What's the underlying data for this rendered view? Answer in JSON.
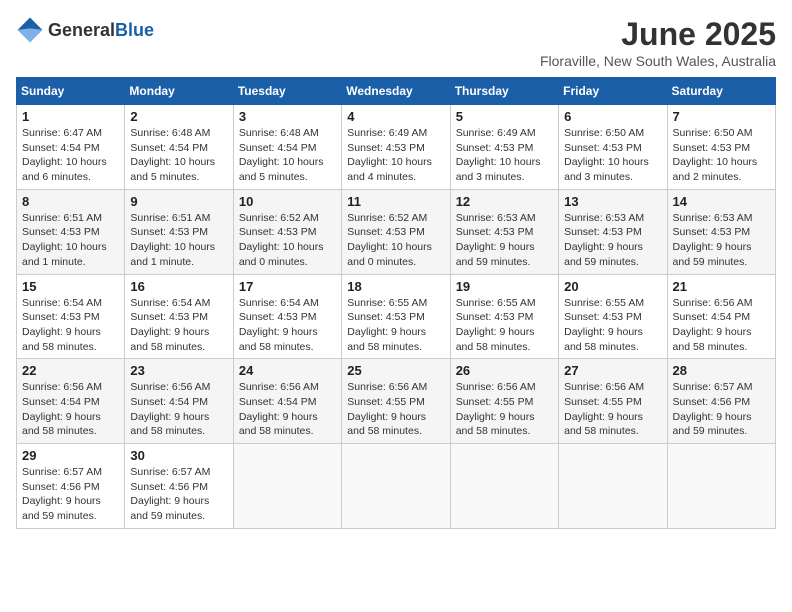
{
  "header": {
    "logo_general": "General",
    "logo_blue": "Blue",
    "month_title": "June 2025",
    "location": "Floraville, New South Wales, Australia"
  },
  "weekdays": [
    "Sunday",
    "Monday",
    "Tuesday",
    "Wednesday",
    "Thursday",
    "Friday",
    "Saturday"
  ],
  "weeks": [
    [
      {
        "day": "1",
        "info": "Sunrise: 6:47 AM\nSunset: 4:54 PM\nDaylight: 10 hours\nand 6 minutes."
      },
      {
        "day": "2",
        "info": "Sunrise: 6:48 AM\nSunset: 4:54 PM\nDaylight: 10 hours\nand 5 minutes."
      },
      {
        "day": "3",
        "info": "Sunrise: 6:48 AM\nSunset: 4:54 PM\nDaylight: 10 hours\nand 5 minutes."
      },
      {
        "day": "4",
        "info": "Sunrise: 6:49 AM\nSunset: 4:53 PM\nDaylight: 10 hours\nand 4 minutes."
      },
      {
        "day": "5",
        "info": "Sunrise: 6:49 AM\nSunset: 4:53 PM\nDaylight: 10 hours\nand 3 minutes."
      },
      {
        "day": "6",
        "info": "Sunrise: 6:50 AM\nSunset: 4:53 PM\nDaylight: 10 hours\nand 3 minutes."
      },
      {
        "day": "7",
        "info": "Sunrise: 6:50 AM\nSunset: 4:53 PM\nDaylight: 10 hours\nand 2 minutes."
      }
    ],
    [
      {
        "day": "8",
        "info": "Sunrise: 6:51 AM\nSunset: 4:53 PM\nDaylight: 10 hours\nand 1 minute."
      },
      {
        "day": "9",
        "info": "Sunrise: 6:51 AM\nSunset: 4:53 PM\nDaylight: 10 hours\nand 1 minute."
      },
      {
        "day": "10",
        "info": "Sunrise: 6:52 AM\nSunset: 4:53 PM\nDaylight: 10 hours\nand 0 minutes."
      },
      {
        "day": "11",
        "info": "Sunrise: 6:52 AM\nSunset: 4:53 PM\nDaylight: 10 hours\nand 0 minutes."
      },
      {
        "day": "12",
        "info": "Sunrise: 6:53 AM\nSunset: 4:53 PM\nDaylight: 9 hours\nand 59 minutes."
      },
      {
        "day": "13",
        "info": "Sunrise: 6:53 AM\nSunset: 4:53 PM\nDaylight: 9 hours\nand 59 minutes."
      },
      {
        "day": "14",
        "info": "Sunrise: 6:53 AM\nSunset: 4:53 PM\nDaylight: 9 hours\nand 59 minutes."
      }
    ],
    [
      {
        "day": "15",
        "info": "Sunrise: 6:54 AM\nSunset: 4:53 PM\nDaylight: 9 hours\nand 58 minutes."
      },
      {
        "day": "16",
        "info": "Sunrise: 6:54 AM\nSunset: 4:53 PM\nDaylight: 9 hours\nand 58 minutes."
      },
      {
        "day": "17",
        "info": "Sunrise: 6:54 AM\nSunset: 4:53 PM\nDaylight: 9 hours\nand 58 minutes."
      },
      {
        "day": "18",
        "info": "Sunrise: 6:55 AM\nSunset: 4:53 PM\nDaylight: 9 hours\nand 58 minutes."
      },
      {
        "day": "19",
        "info": "Sunrise: 6:55 AM\nSunset: 4:53 PM\nDaylight: 9 hours\nand 58 minutes."
      },
      {
        "day": "20",
        "info": "Sunrise: 6:55 AM\nSunset: 4:53 PM\nDaylight: 9 hours\nand 58 minutes."
      },
      {
        "day": "21",
        "info": "Sunrise: 6:56 AM\nSunset: 4:54 PM\nDaylight: 9 hours\nand 58 minutes."
      }
    ],
    [
      {
        "day": "22",
        "info": "Sunrise: 6:56 AM\nSunset: 4:54 PM\nDaylight: 9 hours\nand 58 minutes."
      },
      {
        "day": "23",
        "info": "Sunrise: 6:56 AM\nSunset: 4:54 PM\nDaylight: 9 hours\nand 58 minutes."
      },
      {
        "day": "24",
        "info": "Sunrise: 6:56 AM\nSunset: 4:54 PM\nDaylight: 9 hours\nand 58 minutes."
      },
      {
        "day": "25",
        "info": "Sunrise: 6:56 AM\nSunset: 4:55 PM\nDaylight: 9 hours\nand 58 minutes."
      },
      {
        "day": "26",
        "info": "Sunrise: 6:56 AM\nSunset: 4:55 PM\nDaylight: 9 hours\nand 58 minutes."
      },
      {
        "day": "27",
        "info": "Sunrise: 6:56 AM\nSunset: 4:55 PM\nDaylight: 9 hours\nand 58 minutes."
      },
      {
        "day": "28",
        "info": "Sunrise: 6:57 AM\nSunset: 4:56 PM\nDaylight: 9 hours\nand 59 minutes."
      }
    ],
    [
      {
        "day": "29",
        "info": "Sunrise: 6:57 AM\nSunset: 4:56 PM\nDaylight: 9 hours\nand 59 minutes."
      },
      {
        "day": "30",
        "info": "Sunrise: 6:57 AM\nSunset: 4:56 PM\nDaylight: 9 hours\nand 59 minutes."
      },
      {
        "day": "",
        "info": ""
      },
      {
        "day": "",
        "info": ""
      },
      {
        "day": "",
        "info": ""
      },
      {
        "day": "",
        "info": ""
      },
      {
        "day": "",
        "info": ""
      }
    ]
  ]
}
